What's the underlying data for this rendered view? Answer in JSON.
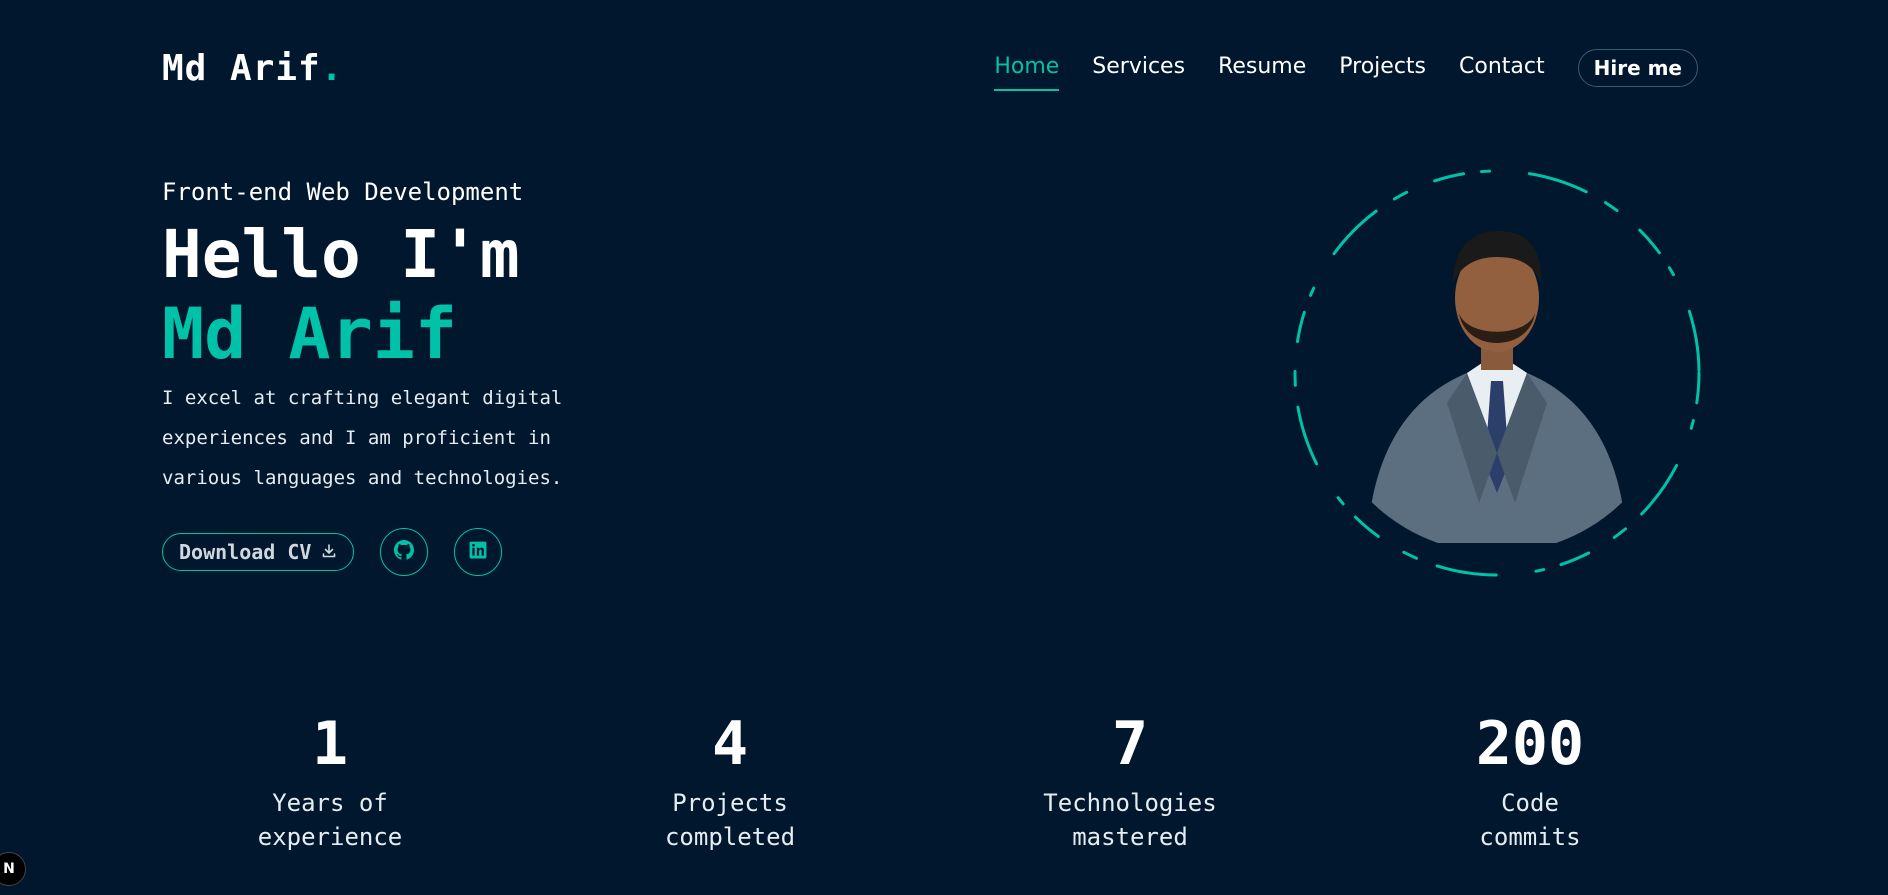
{
  "header": {
    "logo_text": "Md Arif",
    "logo_dot": ".",
    "nav": [
      {
        "label": "Home",
        "active": true
      },
      {
        "label": "Services",
        "active": false
      },
      {
        "label": "Resume",
        "active": false
      },
      {
        "label": "Projects",
        "active": false
      },
      {
        "label": "Contact",
        "active": false
      }
    ],
    "hire_label": "Hire me"
  },
  "hero": {
    "subtitle": "Front-end Web Development",
    "greeting": "Hello I'm",
    "name": "Md Arif",
    "description": "I excel at crafting elegant digital experiences and I am proficient in various languages and technologies.",
    "download_label": "Download CV",
    "socials": [
      {
        "icon": "github-icon"
      },
      {
        "icon": "linkedin-icon"
      }
    ]
  },
  "stats": [
    {
      "number": "1",
      "label": "Years of experience"
    },
    {
      "number": "4",
      "label": "Projects completed"
    },
    {
      "number": "7",
      "label": "Technologies mastered"
    },
    {
      "number": "200",
      "label": "Code commits"
    }
  ],
  "corner_badge": "N",
  "colors": {
    "background": "#00172d",
    "accent": "#00c2a8",
    "text": "#ffffff"
  }
}
